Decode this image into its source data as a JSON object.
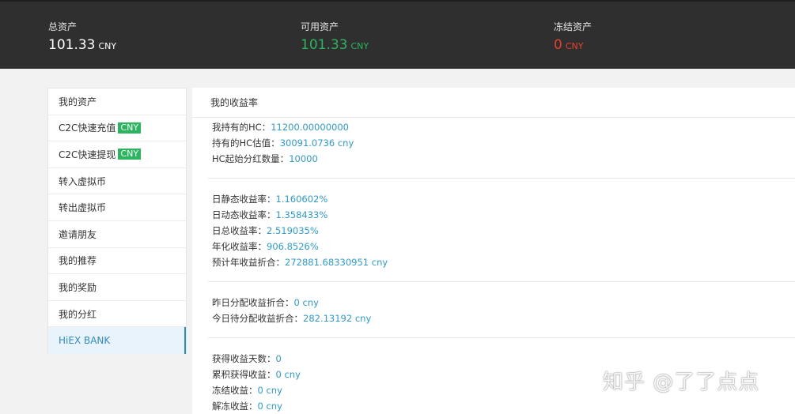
{
  "summary": {
    "total": {
      "label": "总资产",
      "value": "101.33",
      "currency": "CNY"
    },
    "available": {
      "label": "可用资产",
      "value": "101.33",
      "currency": "CNY"
    },
    "frozen": {
      "label": "冻结资产",
      "value": "0",
      "currency": "CNY"
    }
  },
  "sidebar": {
    "items": [
      {
        "label": "我的资产"
      },
      {
        "label": "C2C快速充值",
        "tag": "CNY"
      },
      {
        "label": "C2C快速提现",
        "tag": "CNY"
      },
      {
        "label": "转入虚拟币"
      },
      {
        "label": "转出虚拟币"
      },
      {
        "label": "邀请朋友"
      },
      {
        "label": "我的推荐"
      },
      {
        "label": "我的奖励"
      },
      {
        "label": "我的分红"
      },
      {
        "label": "HiEX BANK",
        "active": true
      }
    ]
  },
  "main": {
    "title": "我的收益率",
    "groups": [
      [
        {
          "label": "我持有的HC：",
          "value": "11200.00000000"
        },
        {
          "label": "持有的HC估值：",
          "value": "30091.0736 cny"
        },
        {
          "label": "HC起始分红数量：",
          "value": "10000"
        }
      ],
      [
        {
          "label": "日静态收益率：",
          "value": "1.160602%"
        },
        {
          "label": "日动态收益率：",
          "value": "1.358433%"
        },
        {
          "label": "日总收益率：",
          "value": "2.519035%"
        },
        {
          "label": "年化收益率：",
          "value": "906.8526%"
        },
        {
          "label": "预计年收益折合：",
          "value": "272881.68330951 cny"
        }
      ],
      [
        {
          "label": "昨日分配收益折合：",
          "value": "0 cny"
        },
        {
          "label": "今日待分配收益折合：",
          "value": "282.13192 cny"
        }
      ],
      [
        {
          "label": "获得收益天数：",
          "value": "0"
        },
        {
          "label": "累积获得收益：",
          "value": "0 cny"
        },
        {
          "label": "冻结收益：",
          "value": "0 cny"
        },
        {
          "label": "解冻收益：",
          "value": "0 cny"
        }
      ]
    ]
  },
  "watermark": "知乎 @了了点点",
  "colors": {
    "header_bg": "#2f2f2f",
    "available_green": "#2ab55e",
    "frozen_red": "#e8402e",
    "value_blue": "#2d9bd2",
    "active_blue": "#2e8bc9"
  }
}
